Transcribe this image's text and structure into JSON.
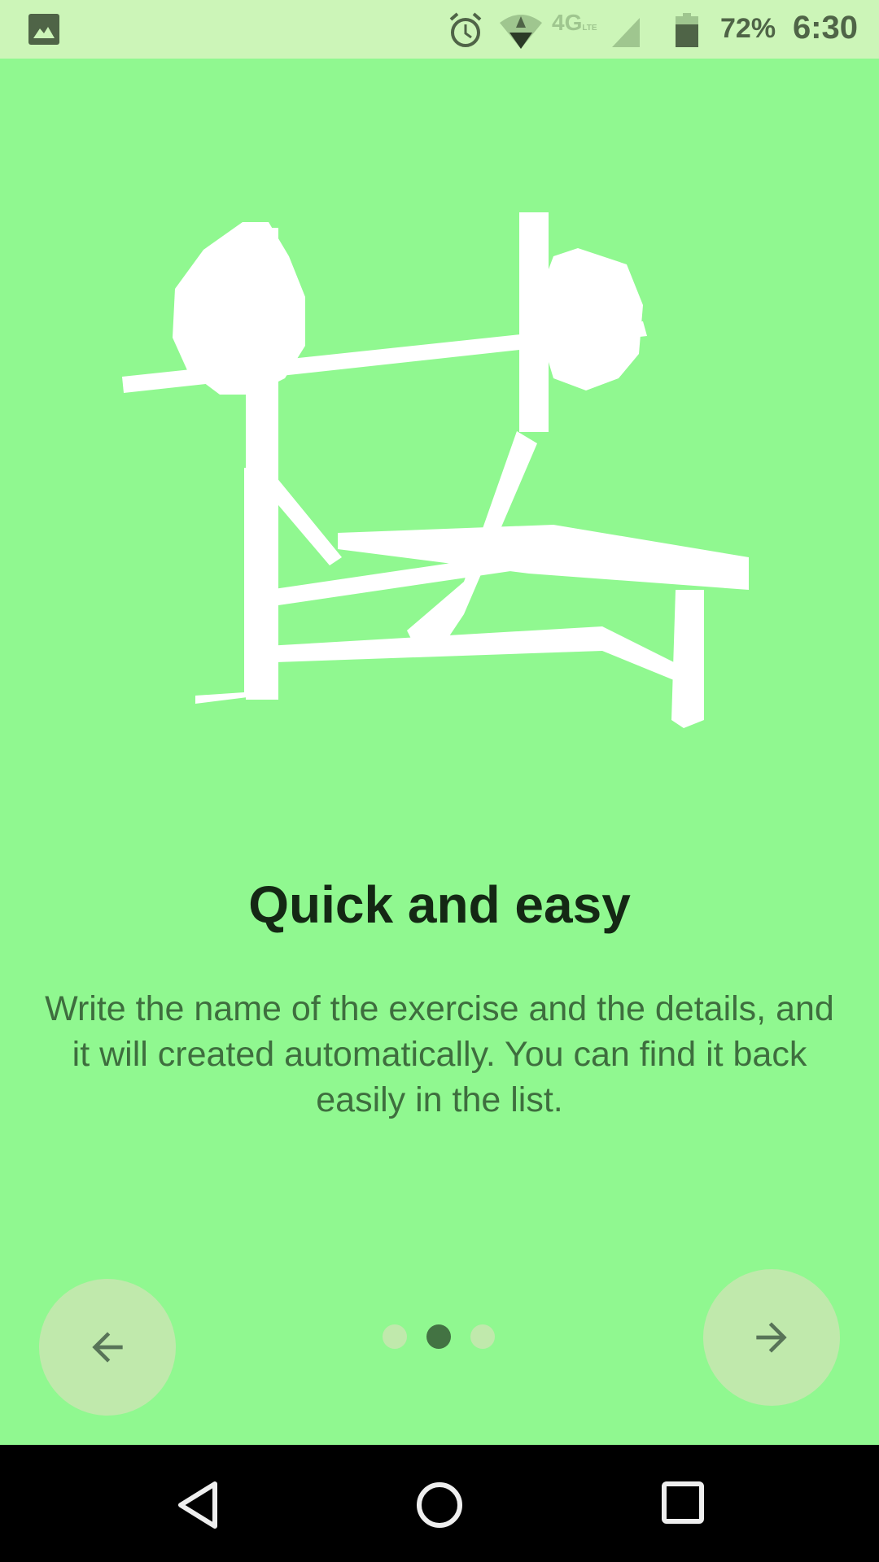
{
  "status_bar": {
    "battery_percent": "72%",
    "time": "6:30",
    "network": "4G",
    "network_sub": "LTE",
    "icons": [
      "gallery-icon",
      "alarm-icon",
      "wifi-icon",
      "lte-icon",
      "signal-icon",
      "battery-icon"
    ]
  },
  "onboarding": {
    "title": "Quick and easy",
    "description": "Write the name of the exercise and the details, and it will created automatically. You can find it back easily in the list.",
    "page_indicator": {
      "current": 2,
      "total": 3
    },
    "prev_icon": "arrow-left-icon",
    "next_icon": "arrow-right-icon"
  },
  "colors": {
    "background": "#90f890",
    "status_bar": "#ccf5b8",
    "button": "#c0e9ac",
    "dot_active": "#437343",
    "text": "#3e6e3e"
  }
}
